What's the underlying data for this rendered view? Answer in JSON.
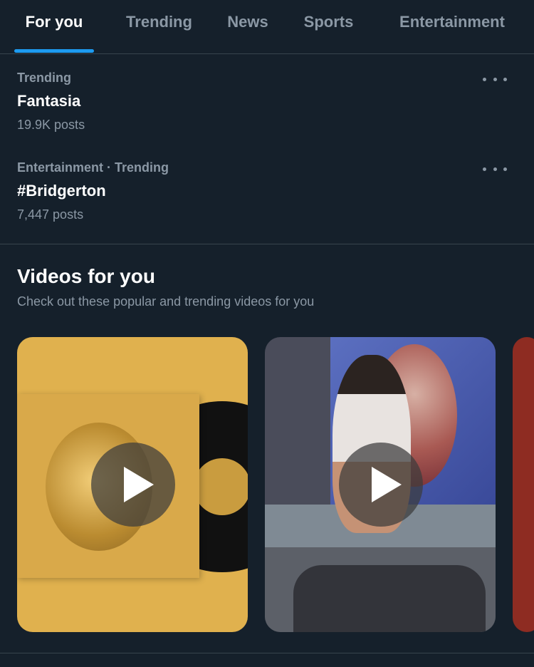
{
  "tabs": [
    {
      "label": "For you",
      "active": true
    },
    {
      "label": "Trending"
    },
    {
      "label": "News"
    },
    {
      "label": "Sports"
    },
    {
      "label": "Entertainment"
    }
  ],
  "trends": [
    {
      "meta": "Trending",
      "title": "Fantasia",
      "count": "19.9K posts"
    },
    {
      "meta": "Entertainment · Trending",
      "title": "#Bridgerton",
      "count": "7,447 posts"
    }
  ],
  "videos_section": {
    "title": "Videos for you",
    "subtitle": "Check out these popular and trending videos for you"
  },
  "colors": {
    "background": "#15202b",
    "accent": "#1d9bf0",
    "secondary_text": "#8b98a5",
    "divider": "#38444d"
  },
  "icons": [
    "more-options-icon",
    "play-icon"
  ]
}
